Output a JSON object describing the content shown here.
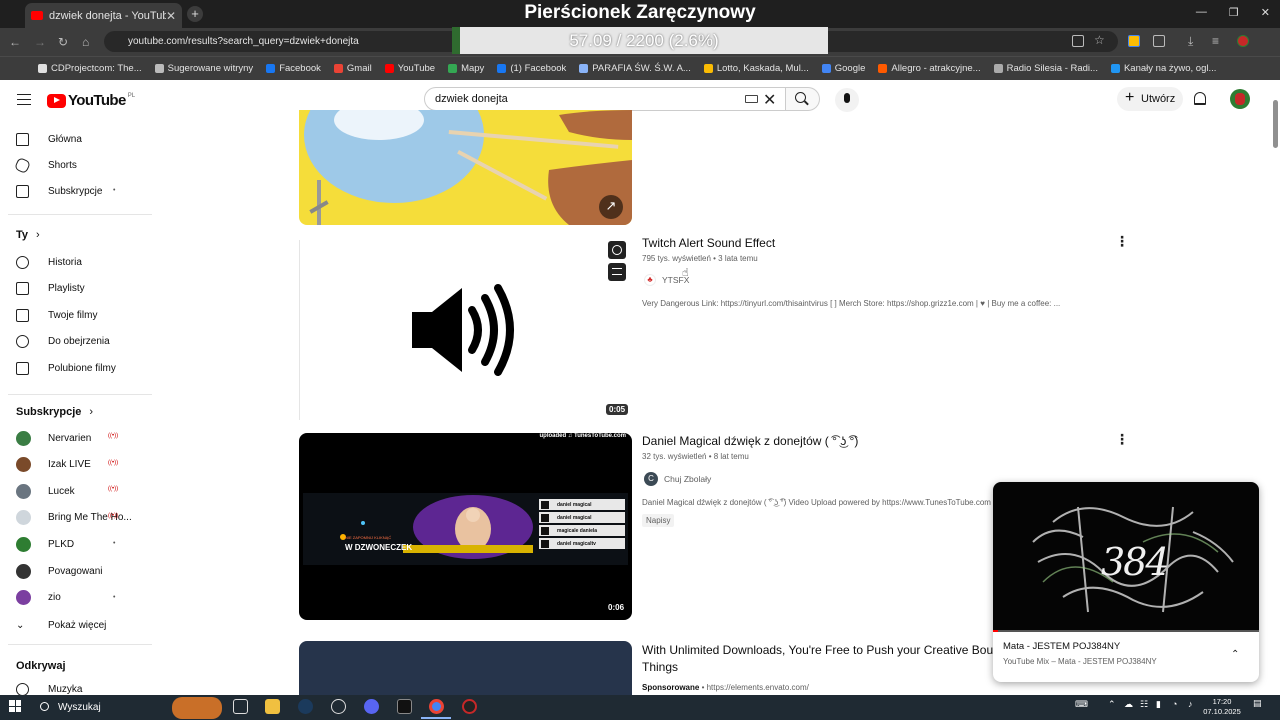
{
  "browser": {
    "tab_title": "dzwiek donejta - YouTube",
    "url": "youtube.com/results?search_query=dzwiek+donejta",
    "bookmarks": [
      {
        "label": "CDProjectcom: The...",
        "color": "#e0e0e0"
      },
      {
        "label": "Sugerowane witryny",
        "color": "#bbbbbb"
      },
      {
        "label": "Facebook",
        "color": "#1877f2"
      },
      {
        "label": "Gmail",
        "color": "#ea4335"
      },
      {
        "label": "YouTube",
        "color": "#ff0000"
      },
      {
        "label": "Mapy",
        "color": "#34a853"
      },
      {
        "label": "(1) Facebook",
        "color": "#1877f2"
      },
      {
        "label": "PARAFIA ŚW. Ś.W. A...",
        "color": "#8ab4f8"
      },
      {
        "label": "Lotto, Kaskada, Mul...",
        "color": "#fbbc04"
      },
      {
        "label": "Google",
        "color": "#4285f4"
      },
      {
        "label": "Allegro - atrakcyjne...",
        "color": "#ff5a00"
      },
      {
        "label": "Radio Silesia - Radi...",
        "color": "#aaaaaa"
      },
      {
        "label": "Kanały na żywo, ogl...",
        "color": "#2196f3"
      }
    ]
  },
  "overlay": {
    "title": "Pierścionek Zaręczynowy",
    "progress": "57.09 / 2200 (2.6%)",
    "progress_fraction": 0.026
  },
  "youtube": {
    "logo": "YouTube",
    "country": "PL",
    "search_query": "dzwiek donejta",
    "create_label": "Utwórz"
  },
  "sidebar": {
    "main": [
      {
        "label": "Główna",
        "icon": "home-icon"
      },
      {
        "label": "Shorts",
        "icon": "shorts-icon"
      },
      {
        "label": "Subskrypcje",
        "icon": "subscriptions-icon"
      }
    ],
    "you_header": "Ty",
    "you": [
      {
        "label": "Historia",
        "icon": "history-icon"
      },
      {
        "label": "Playlisty",
        "icon": "playlists-icon"
      },
      {
        "label": "Twoje filmy",
        "icon": "your-videos-icon"
      },
      {
        "label": "Do obejrzenia",
        "icon": "watch-later-icon"
      },
      {
        "label": "Polubione filmy",
        "icon": "liked-icon"
      }
    ],
    "subs_header": "Subskrypcje",
    "subs": [
      {
        "label": "Nervarien",
        "color": "#3a7d44"
      },
      {
        "label": "Izak LIVE",
        "color": "#7a4a2a"
      },
      {
        "label": "Lucek",
        "color": "#6a7580"
      },
      {
        "label": "Bring Me The Ho...",
        "color": "#cfd6dc"
      },
      {
        "label": "PLKD",
        "color": "#2e7d32"
      },
      {
        "label": "Povagowani",
        "color": "#333333"
      },
      {
        "label": "zio",
        "color": "#7b3fa0"
      }
    ],
    "more": "Pokaż więcej",
    "explore_header": "Odkrywaj",
    "explore": [
      {
        "label": "Muzyka",
        "icon": "music-icon"
      }
    ]
  },
  "results": [
    {
      "title": "Twitch Alert Sound Effect",
      "meta": "795 tys. wyświetleń • 3 lata temu",
      "channel": "YTSFX",
      "description": "Very Dangerous Link: https://tinyurl.com/thisaintvirus [ ] Merch Store: https://shop.grizz1e.com | ♥ | Buy me a coffee: ...",
      "duration": "0:05"
    },
    {
      "title": "Daniel Magical dźwięk z donejtów ( ͡° ͜ʖ ͡°)",
      "meta": "32 tys. wyświetleń • 8 lat temu",
      "channel": "Chuj Zbolały",
      "channel_initial": "C",
      "description": "Daniel Magical dźwięk z donejtów ( ͡° ͜ʖ ͡°) Video Upload powered by https://www.TunesToTube.com",
      "chip": "Napisy",
      "duration": "0:06",
      "thumb_watermark": "uploaded ♫ TunesToTube.com",
      "thumb_banner": "W DZWONECZEK",
      "thumb_banner_small": "NIE ZAPOMNIJ KLIKNĄĆ",
      "thumb_socials": [
        "daniel magical",
        "daniel magical",
        "magicale daniela",
        "daniel magicaltv"
      ]
    },
    {
      "title_line1": "With Unlimited Downloads, You're Free to Push your Creative Boun",
      "title_line2": "Things",
      "sponsored": "Sponsorowane",
      "url": "https://elements.envato.com/"
    }
  ],
  "miniplayer": {
    "title": "Mata - JESTEM POJ384NY",
    "subtitle": "YouTube Mix – Mata - JESTEM POJ384NY",
    "graphic_text": "384",
    "progress_fraction": 0.02
  },
  "taskbar": {
    "search_label": "Wyszukaj",
    "time": "17:20",
    "date": "07.10.2025"
  }
}
